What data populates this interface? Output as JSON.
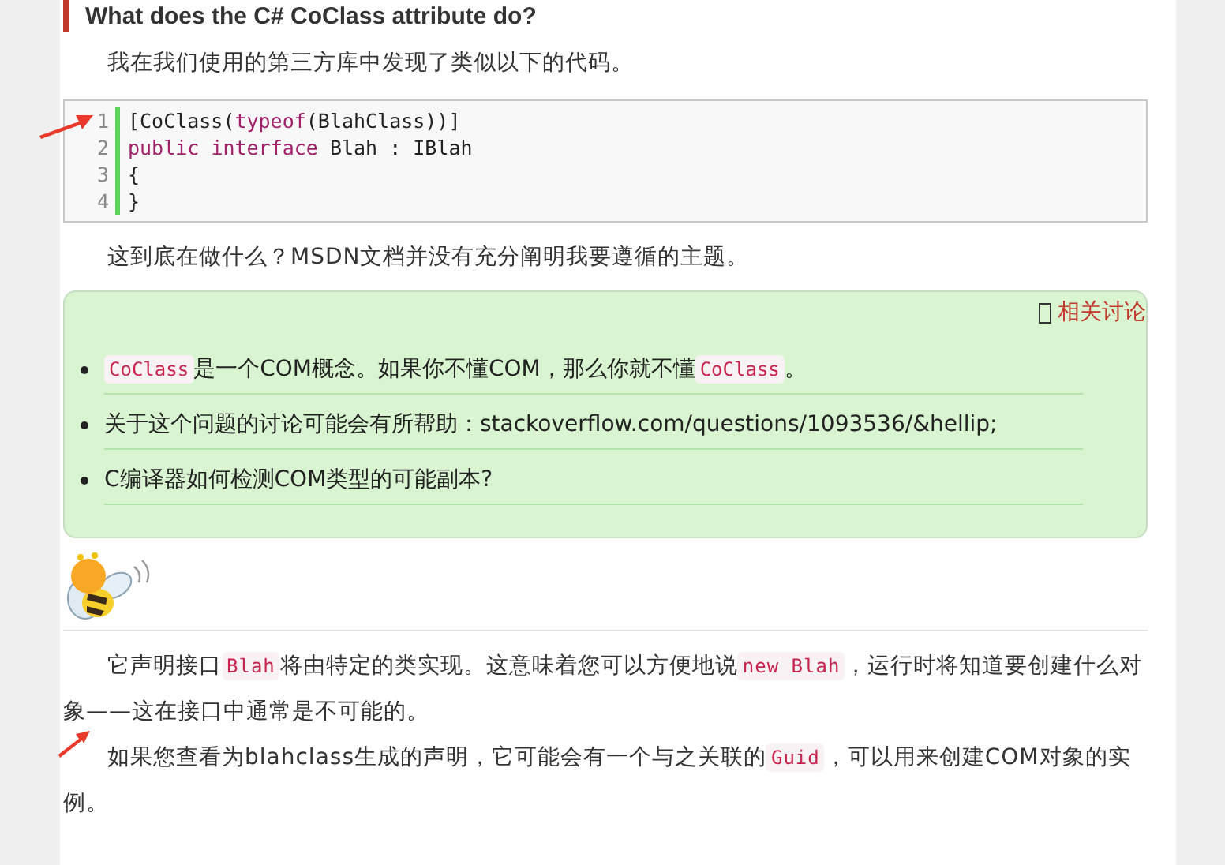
{
  "heading": "What does the C# CoClass attribute do?",
  "intro": "我在我们使用的第三方库中发现了类似以下的代码。",
  "code": {
    "lines": [
      {
        "number": "1",
        "tokens": [
          {
            "kind": "plain",
            "text": "[CoClass("
          },
          {
            "kind": "keyword",
            "text": "typeof"
          },
          {
            "kind": "plain",
            "text": "(BlahClass))]"
          }
        ]
      },
      {
        "number": "2",
        "tokens": [
          {
            "kind": "keyword",
            "text": "public "
          },
          {
            "kind": "keyword",
            "text": "interface"
          },
          {
            "kind": "plain",
            "text": " Blah : IBlah"
          }
        ]
      },
      {
        "number": "3",
        "tokens": [
          {
            "kind": "plain",
            "text": "{"
          }
        ]
      },
      {
        "number": "4",
        "tokens": [
          {
            "kind": "plain",
            "text": "}"
          }
        ]
      }
    ]
  },
  "question": "这到底在做什么？MSDN文档并没有充分阐明我要遵循的主题。",
  "related": {
    "link": "相关讨论",
    "items": [
      {
        "segments": [
          {
            "kind": "code",
            "text": "CoClass"
          },
          {
            "kind": "text",
            "text": "是一个COM概念。如果你不懂COM，那么你就不懂"
          },
          {
            "kind": "code",
            "text": "CoClass"
          },
          {
            "kind": "text",
            "text": "。"
          }
        ]
      },
      {
        "segments": [
          {
            "kind": "text",
            "text": "关于这个问题的讨论可能会有所帮助：stackoverflow.com/questions/1093536/&hellip;"
          }
        ]
      },
      {
        "segments": [
          {
            "kind": "text",
            "text": "C编译器如何检测COM类型的可能副本?"
          }
        ]
      }
    ]
  },
  "paragraphs": [
    {
      "segments": [
        {
          "kind": "text",
          "text": "它声明接口"
        },
        {
          "kind": "code",
          "text": "Blah"
        },
        {
          "kind": "text",
          "text": "将由特定的类实现。这意味着您可以方便地说"
        },
        {
          "kind": "code",
          "text": "new Blah"
        },
        {
          "kind": "text",
          "text": "，运行时将知道要创建什么对象——这在接口中通常是不可能的。"
        }
      ]
    },
    {
      "segments": [
        {
          "kind": "text",
          "text": "如果您查看为blahclass生成的声明，它可能会有一个与之关联的"
        },
        {
          "kind": "code",
          "text": "Guid"
        },
        {
          "kind": "text",
          "text": "，可以用来创建COM对象的实例。"
        }
      ]
    }
  ]
}
